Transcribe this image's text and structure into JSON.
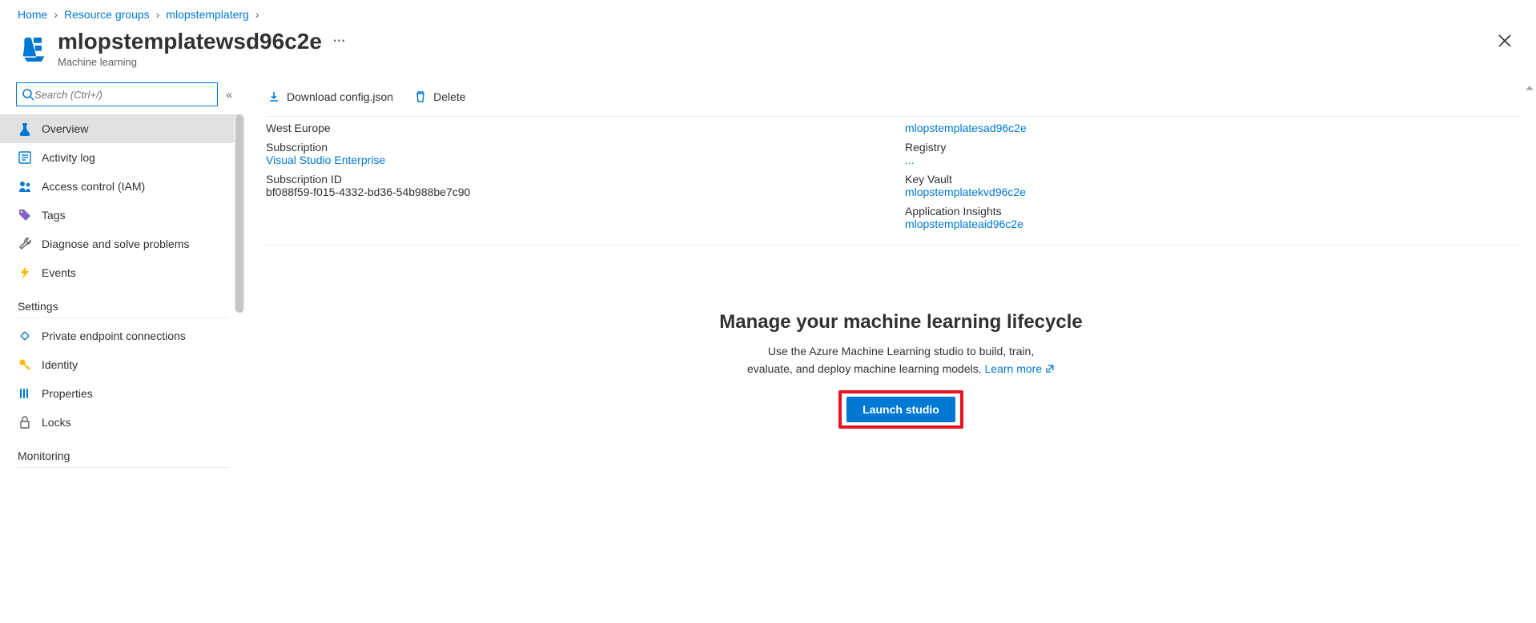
{
  "breadcrumb": [
    {
      "label": "Home"
    },
    {
      "label": "Resource groups"
    },
    {
      "label": "mlopstemplaterg"
    }
  ],
  "header": {
    "title": "mlopstemplatewsd96c2e",
    "subtitle": "Machine learning"
  },
  "search": {
    "placeholder": "Search (Ctrl+/)"
  },
  "toolbar": {
    "download": "Download config.json",
    "delete": "Delete"
  },
  "nav": {
    "items": [
      {
        "label": "Overview"
      },
      {
        "label": "Activity log"
      },
      {
        "label": "Access control (IAM)"
      },
      {
        "label": "Tags"
      },
      {
        "label": "Diagnose and solve problems"
      },
      {
        "label": "Events"
      }
    ],
    "settings_heading": "Settings",
    "settings": [
      {
        "label": "Private endpoint connections"
      },
      {
        "label": "Identity"
      },
      {
        "label": "Properties"
      },
      {
        "label": "Locks"
      }
    ],
    "monitoring_heading": "Monitoring"
  },
  "essentials": {
    "left": {
      "region": "West Europe",
      "subscription_label": "Subscription",
      "subscription_value": "Visual Studio Enterprise",
      "subid_label": "Subscription ID",
      "subid_value": "bf088f59-f015-4332-bd36-54b988be7c90"
    },
    "right": {
      "storage": "mlopstemplatesad96c2e",
      "registry_label": "Registry",
      "registry_value": "...",
      "keyvault_label": "Key Vault",
      "keyvault_value": "mlopstemplatekvd96c2e",
      "appinsights_label": "Application Insights",
      "appinsights_value": "mlopstemplateaid96c2e"
    }
  },
  "promo": {
    "title": "Manage your machine learning lifecycle",
    "desc_a": "Use the Azure Machine Learning studio to build, train,",
    "desc_b": "evaluate, and deploy machine learning models.",
    "learn_more": "Learn more",
    "launch": "Launch studio"
  }
}
